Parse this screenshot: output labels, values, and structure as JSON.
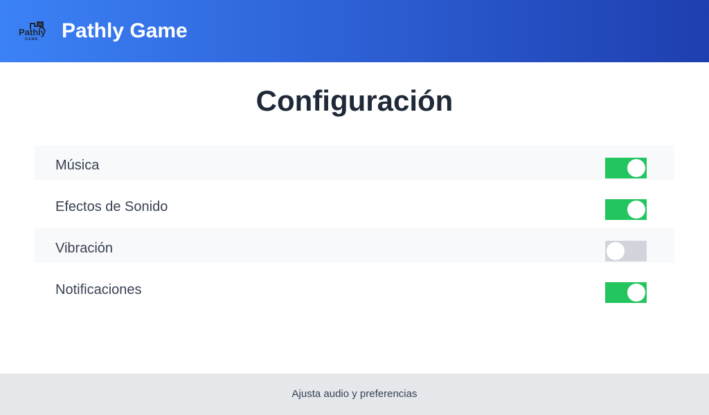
{
  "header": {
    "logo_text": "Pathly",
    "logo_subtext": "GAME",
    "title": "Pathly Game",
    "colors": {
      "gradient_start": "#3b82f6",
      "gradient_end": "#1e3faf"
    }
  },
  "page": {
    "title": "Configuración"
  },
  "settings": [
    {
      "label": "Música",
      "enabled": true
    },
    {
      "label": "Efectos de Sonido",
      "enabled": true
    },
    {
      "label": "Vibración",
      "enabled": false
    },
    {
      "label": "Notificaciones",
      "enabled": true
    }
  ],
  "toggle_colors": {
    "on": "#22c55e",
    "off": "#d1d5db"
  },
  "footer": {
    "text": "Ajusta audio y preferencias"
  }
}
